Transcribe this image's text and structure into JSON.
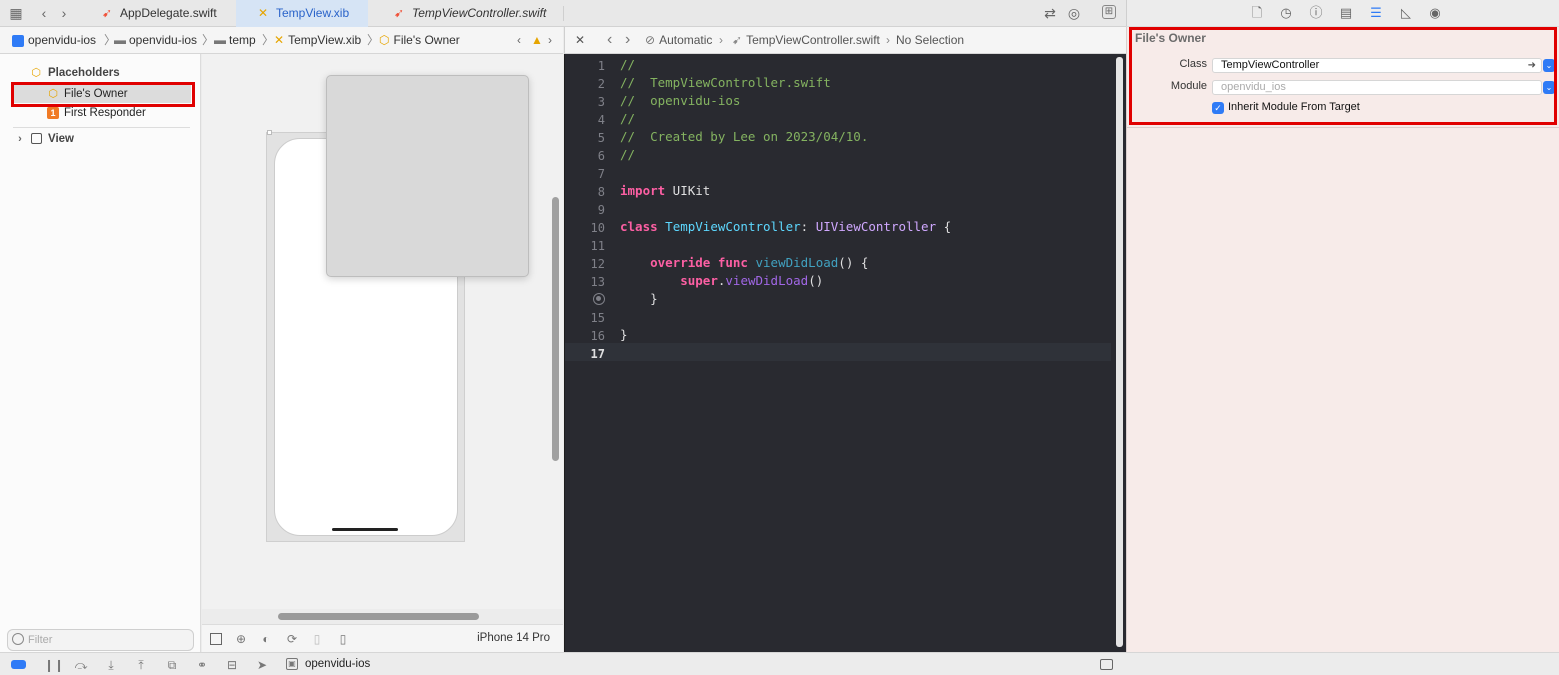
{
  "tabs": [
    {
      "label": "AppDelegate.swift",
      "icon": "swift-icon"
    },
    {
      "label": "TempView.xib",
      "icon": "xib-icon"
    },
    {
      "label": "TempViewController.swift",
      "icon": "swift-icon"
    }
  ],
  "breadcrumb": {
    "items": [
      "openvidu-ios",
      "openvidu-ios",
      "temp",
      "TempView.xib",
      "File's Owner"
    ]
  },
  "editor_breadcrumb": {
    "items": [
      "Automatic",
      "TempViewController.swift",
      "No Selection"
    ]
  },
  "outline": {
    "placeholders_label": "Placeholders",
    "files_owner": "File's Owner",
    "first_responder": "First Responder",
    "first_responder_badge": "1",
    "view": "View"
  },
  "filter": {
    "placeholder": "Filter"
  },
  "canvas": {
    "device": "iPhone 14 Pro"
  },
  "code": {
    "line_numbers": [
      "1",
      "2",
      "3",
      "4",
      "5",
      "6",
      "7",
      "8",
      "9",
      "10",
      "11",
      "12",
      "13",
      "",
      "15",
      "16",
      "17"
    ],
    "l1": "//",
    "l2": "//  TempViewController.swift",
    "l3": "//  openvidu-ios",
    "l4": "//",
    "l5": "//  Created by Lee on 2023/04/10.",
    "l6": "//",
    "l8_kw": "import",
    "l8_rest": " UIKit",
    "l10_kw": "class",
    "l10_name": "TempViewController",
    "l10_colon": ": ",
    "l10_super": "UIViewController",
    "l10_brace": " {",
    "l12_kw1": "override",
    "l12_kw2": "func",
    "l12_fn": "viewDidLoad",
    "l12_rest": "() {",
    "l13_kw": "super",
    "l13_dot": ".",
    "l13_fn": "viewDidLoad",
    "l13_rest": "()",
    "l14": "}",
    "l16": "}"
  },
  "inspector": {
    "section_title": "File's Owner",
    "class_label": "Class",
    "class_value": "TempViewController",
    "module_label": "Module",
    "module_placeholder": "openvidu_ios",
    "inherit_label": "Inherit Module From Target",
    "inherit_checked": true
  },
  "status": {
    "scheme": "openvidu-ios"
  },
  "colors": {
    "accent": "#2f7bf6",
    "highlight": "#e00000",
    "editor_bg": "#292a30"
  }
}
